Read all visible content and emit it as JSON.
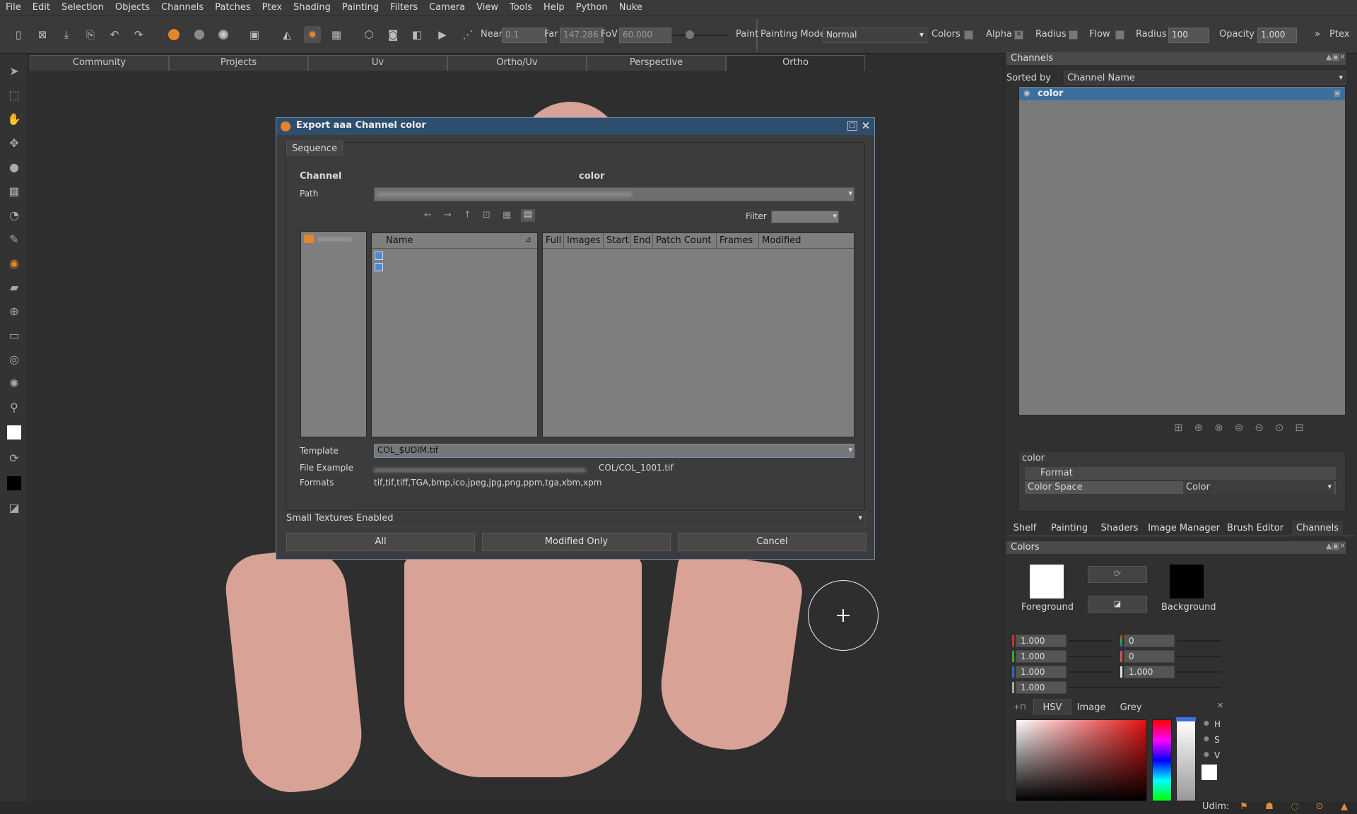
{
  "menu": [
    "File",
    "Edit",
    "Selection",
    "Objects",
    "Channels",
    "Patches",
    "Ptex",
    "Shading",
    "Painting",
    "Filters",
    "Camera",
    "View",
    "Tools",
    "Help",
    "Python",
    "Nuke"
  ],
  "toolbar": {
    "near_label": "Near",
    "near_value": "0.1",
    "far_label": "Far",
    "far_value": "147.286",
    "fov_label": "FoV",
    "fov_value": "60.000",
    "paint_label": "Paint",
    "painting_mode_label": "Painting Mode",
    "painting_mode_value": "Normal",
    "colors_label": "Colors",
    "alpha_label": "Alpha",
    "alpha_check": "✕",
    "radius_label": "Radius",
    "flow_label": "Flow",
    "radius2_label": "Radius",
    "radius_value": "100",
    "opacity_label": "Opacity",
    "opacity_value": "1.000",
    "more": "»",
    "ptex_label": "Ptex"
  },
  "view_tabs": [
    "Community",
    "Projects",
    "Uv",
    "Ortho/Uv",
    "Perspective",
    "Ortho"
  ],
  "dialog": {
    "title": "Export aaa Channel color",
    "tab": "Sequence",
    "channel_label": "Channel",
    "channel_value": "color",
    "path_label": "Path",
    "filter_label": "Filter",
    "name_header": "Name",
    "columns": [
      "Full",
      "Images",
      "Start",
      "End",
      "Patch Count",
      "Frames",
      "Modified"
    ],
    "template_label": "Template",
    "template_value": "COL_$UDIM.tif",
    "file_example_label": "File Example",
    "file_example_value": "COL/COL_1001.tif",
    "formats_label": "Formats",
    "formats_value": "tif,tif,tiff,TGA,bmp,ico,jpeg,jpg,png,ppm,tga,xbm,xpm",
    "small_textures_label": "Small Textures",
    "small_textures_value": "Enabled",
    "buttons": {
      "all": "All",
      "modified": "Modified Only",
      "cancel": "Cancel"
    }
  },
  "channels_panel": {
    "title": "Channels",
    "sorted_by_label": "Sorted by",
    "sorted_by_value": "Channel Name",
    "channel_item": "color",
    "props_channel": "color",
    "props_section": "Format",
    "color_space_label": "Color Space",
    "color_space_value": "Color"
  },
  "right_tabs": [
    "Shelf",
    "Painting",
    "Shaders",
    "Image Manager",
    "Brush Editor",
    "Channels"
  ],
  "colors_panel": {
    "title": "Colors",
    "foreground_label": "Foreground",
    "background_label": "Background",
    "fg_values": [
      "1.000",
      "1.000",
      "1.000",
      "1.000"
    ],
    "hsv_values": [
      "0",
      "0",
      "1.000"
    ],
    "tabs": [
      "HSV",
      "Image",
      "Grey"
    ],
    "hsv_letters": [
      "H",
      "S",
      "V"
    ]
  },
  "status": {
    "udim_label": "Udim:"
  },
  "colors": {
    "accent": "#e3852c",
    "selection": "#3c6e9e",
    "dialog_title": "#2f4d6d"
  }
}
